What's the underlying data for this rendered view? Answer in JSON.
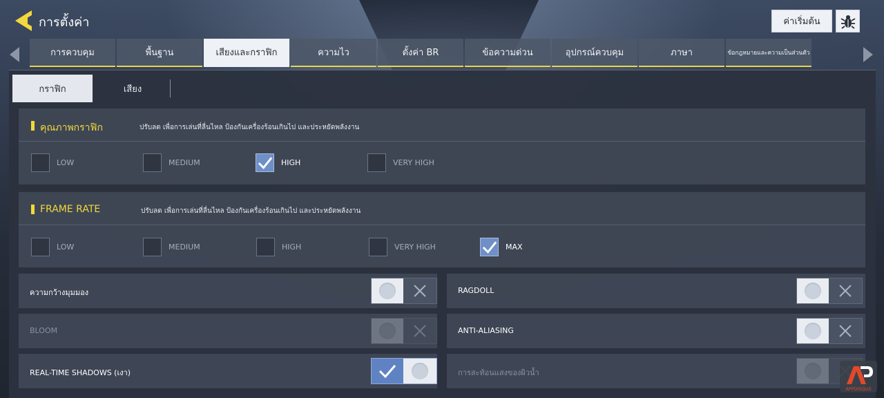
{
  "header": {
    "title": "การตั้งค่า",
    "default_button": "ค่าเริ่มต้น"
  },
  "tabs": [
    {
      "label": "การควบคุม",
      "active": false
    },
    {
      "label": "พื้นฐาน",
      "active": false
    },
    {
      "label": "เสียงและกราฟิก",
      "active": true
    },
    {
      "label": "ความไว",
      "active": false
    },
    {
      "label": "ตั้งค่า BR",
      "active": false
    },
    {
      "label": "ข้อความด่วน",
      "active": false
    },
    {
      "label": "อุปกรณ์ควบคุม",
      "active": false
    },
    {
      "label": "ภาษา",
      "active": false
    },
    {
      "label": "ข้อกฎหมายและความเป็นส่วนตัว",
      "active": false
    }
  ],
  "subtabs": [
    {
      "label": "กราฟิก",
      "active": true
    },
    {
      "label": "เสียง",
      "active": false
    }
  ],
  "graphics_quality": {
    "title": "คุณภาพกราฟิก",
    "description": "ปรับลด เพื่อการเล่นที่ลื่นไหล ป้องกันเครื่องร้อนเกินไป และประหยัดพลังงาน",
    "options": [
      {
        "label": "LOW",
        "checked": false
      },
      {
        "label": "MEDIUM",
        "checked": false
      },
      {
        "label": "HIGH",
        "checked": true
      },
      {
        "label": "VERY HIGH",
        "checked": false
      }
    ]
  },
  "frame_rate": {
    "title": "FRAME RATE",
    "description": "ปรับลด เพื่อการเล่นที่ลื่นไหล ป้องกันเครื่องร้อนเกินไป และประหยัดพลังงาน",
    "options": [
      {
        "label": "LOW",
        "checked": false
      },
      {
        "label": "MEDIUM",
        "checked": false
      },
      {
        "label": "HIGH",
        "checked": false
      },
      {
        "label": "VERY HIGH",
        "checked": false
      },
      {
        "label": "MAX",
        "checked": true
      }
    ]
  },
  "toggles": [
    {
      "label": "ความกว้างมุมมอง",
      "state": "off",
      "disabled": false
    },
    {
      "label": "RAGDOLL",
      "state": "off",
      "disabled": false
    },
    {
      "label": "BLOOM",
      "state": "off",
      "disabled": true
    },
    {
      "label": "ANTI-ALIASING",
      "state": "off",
      "disabled": false
    },
    {
      "label": "REAL-TIME SHADOWS (เงา)",
      "state": "on",
      "disabled": false
    },
    {
      "label": "การสะท้อนแสงของผิวน้ำ",
      "state": "off",
      "disabled": true
    }
  ],
  "watermark": {
    "text": "APPDISQUS"
  },
  "colors": {
    "accent_yellow": "#f2d83c",
    "checked_blue": "#6f8fc7",
    "toggle_on_blue": "#5f83c2",
    "tab_active_bg": "#eef1f5"
  }
}
